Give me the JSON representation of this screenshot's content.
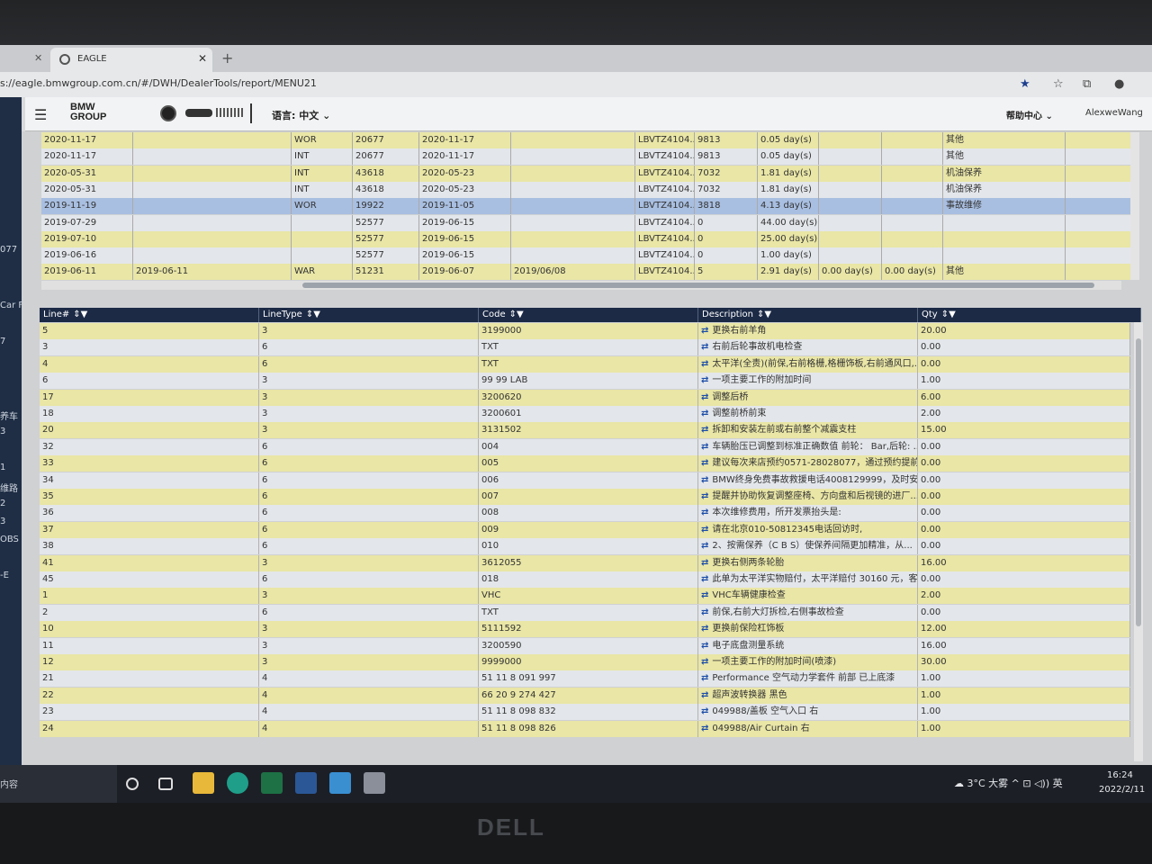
{
  "browser": {
    "tab_title": "EAGLE",
    "url": "s://eagle.bmwgroup.com.cn/#/DWH/DealerTools/report/MENU21"
  },
  "header": {
    "brand_line1": "BMW",
    "brand_line2": "GROUP",
    "language": "语言: 中文",
    "help": "帮助中心",
    "user": "AlexweWang"
  },
  "sidebar": {
    "fragments": [
      "077",
      "Car F",
      "7",
      "养车",
      "3",
      "1",
      "维路",
      "2",
      "3",
      "OBS",
      "-E"
    ]
  },
  "upper_table": {
    "rows": [
      {
        "c1": "2020-11-17",
        "c2": "",
        "c3": "WOR",
        "c4": "20677",
        "c5": "2020-11-17",
        "c6": "",
        "c7": "LBVTZ4104...",
        "c8": "9813",
        "c9": "0.05 day(s)",
        "c10": "",
        "c11": "",
        "c12": "其他",
        "selected": false
      },
      {
        "c1": "2020-11-17",
        "c2": "",
        "c3": "INT",
        "c4": "20677",
        "c5": "2020-11-17",
        "c6": "",
        "c7": "LBVTZ4104...",
        "c8": "9813",
        "c9": "0.05 day(s)",
        "c10": "",
        "c11": "",
        "c12": "其他",
        "selected": false
      },
      {
        "c1": "2020-05-31",
        "c2": "",
        "c3": "INT",
        "c4": "43618",
        "c5": "2020-05-23",
        "c6": "",
        "c7": "LBVTZ4104...",
        "c8": "7032",
        "c9": "1.81 day(s)",
        "c10": "",
        "c11": "",
        "c12": "机油保养",
        "selected": false
      },
      {
        "c1": "2020-05-31",
        "c2": "",
        "c3": "INT",
        "c4": "43618",
        "c5": "2020-05-23",
        "c6": "",
        "c7": "LBVTZ4104...",
        "c8": "7032",
        "c9": "1.81 day(s)",
        "c10": "",
        "c11": "",
        "c12": "机油保养",
        "selected": false
      },
      {
        "c1": "2019-11-19",
        "c2": "",
        "c3": "WOR",
        "c4": "19922",
        "c5": "2019-11-05",
        "c6": "",
        "c7": "LBVTZ4104...",
        "c8": "3818",
        "c9": "4.13 day(s)",
        "c10": "",
        "c11": "",
        "c12": "事故维修",
        "selected": true
      },
      {
        "c1": "2019-07-29",
        "c2": "",
        "c3": "",
        "c4": "52577",
        "c5": "2019-06-15",
        "c6": "",
        "c7": "LBVTZ4104...",
        "c8": "0",
        "c9": "44.00 day(s)",
        "c10": "",
        "c11": "",
        "c12": "",
        "selected": false
      },
      {
        "c1": "2019-07-10",
        "c2": "",
        "c3": "",
        "c4": "52577",
        "c5": "2019-06-15",
        "c6": "",
        "c7": "LBVTZ4104...",
        "c8": "0",
        "c9": "25.00 day(s)",
        "c10": "",
        "c11": "",
        "c12": "",
        "selected": false
      },
      {
        "c1": "2019-06-16",
        "c2": "",
        "c3": "",
        "c4": "52577",
        "c5": "2019-06-15",
        "c6": "",
        "c7": "LBVTZ4104...",
        "c8": "0",
        "c9": "1.00 day(s)",
        "c10": "",
        "c11": "",
        "c12": "",
        "selected": false
      },
      {
        "c1": "2019-06-11",
        "c2": "2019-06-11",
        "c3": "WAR",
        "c4": "51231",
        "c5": "2019-06-07",
        "c6": "2019/06/08",
        "c7": "LBVTZ4104...",
        "c8": "5",
        "c9": "2.91 day(s)",
        "c10": "0.00 day(s)",
        "c11": "0.00 day(s)",
        "c12": "其他",
        "selected": false
      }
    ]
  },
  "lower_table": {
    "headers": [
      "Line#",
      "LineType",
      "Code",
      "Description",
      "Qty"
    ],
    "sort_filter_glyph": "⇕▼",
    "rows": [
      {
        "line": "5",
        "type": "3",
        "code": "3199000",
        "desc": "更换右前羊角",
        "qty": "20.00"
      },
      {
        "line": "3",
        "type": "6",
        "code": "TXT",
        "desc": "右前后轮事故机电检查",
        "qty": "0.00"
      },
      {
        "line": "4",
        "type": "6",
        "code": "TXT",
        "desc": "太平洋(全责)(前保,右前格栅,格栅饰板,右前通风口,...",
        "qty": "0.00"
      },
      {
        "line": "6",
        "type": "3",
        "code": "99 99 LAB",
        "desc": "一项主要工作的附加时间",
        "qty": "1.00"
      },
      {
        "line": "17",
        "type": "3",
        "code": "3200620",
        "desc": "调整后桥",
        "qty": "6.00"
      },
      {
        "line": "18",
        "type": "3",
        "code": "3200601",
        "desc": "调整前桥前束",
        "qty": "2.00"
      },
      {
        "line": "20",
        "type": "3",
        "code": "3131502",
        "desc": "拆卸和安装左前或右前整个减震支柱",
        "qty": "15.00"
      },
      {
        "line": "32",
        "type": "6",
        "code": "004",
        "desc": "车辆胎压已调整到标准正确数值 前轮： Bar,后轮: ...",
        "qty": "0.00"
      },
      {
        "line": "33",
        "type": "6",
        "code": "005",
        "desc": "建议每次来店预约0571-28028077，通过预约提前...",
        "qty": "0.00"
      },
      {
        "line": "34",
        "type": "6",
        "code": "006",
        "desc": "BMW终身免费事故救援电话4008129999，及时安...",
        "qty": "0.00"
      },
      {
        "line": "35",
        "type": "6",
        "code": "007",
        "desc": "提醒并协助恢复调整座椅、方向盘和后视镜的进厂...",
        "qty": "0.00"
      },
      {
        "line": "36",
        "type": "6",
        "code": "008",
        "desc": "本次维修费用，所开发票抬头是:",
        "qty": "0.00"
      },
      {
        "line": "37",
        "type": "6",
        "code": "009",
        "desc": "请在北京010-50812345电话回访时,",
        "qty": "0.00"
      },
      {
        "line": "38",
        "type": "6",
        "code": "010",
        "desc": "2、按需保养（C B S）使保养间隔更加精准，从...",
        "qty": "0.00"
      },
      {
        "line": "41",
        "type": "3",
        "code": "3612055",
        "desc": "更换右侧两条轮胎",
        "qty": "16.00"
      },
      {
        "line": "45",
        "type": "6",
        "code": "018",
        "desc": "此单为太平洋实物赔付，太平洋赔付 30160 元，客...",
        "qty": "0.00"
      },
      {
        "line": "1",
        "type": "3",
        "code": "VHC",
        "desc": "VHC车辆健康检查",
        "qty": "2.00"
      },
      {
        "line": "2",
        "type": "6",
        "code": "TXT",
        "desc": "前保,右前大灯拆检,右侧事故检查",
        "qty": "0.00"
      },
      {
        "line": "10",
        "type": "3",
        "code": "5111592",
        "desc": "更换前保险杠饰板",
        "qty": "12.00"
      },
      {
        "line": "11",
        "type": "3",
        "code": "3200590",
        "desc": "电子底盘测量系统",
        "qty": "16.00"
      },
      {
        "line": "12",
        "type": "3",
        "code": "9999000",
        "desc": "一项主要工作的附加时间(喷漆)",
        "qty": "30.00"
      },
      {
        "line": "21",
        "type": "4",
        "code": "51 11 8 091 997",
        "desc": "Performance 空气动力学套件 前部 已上底漆",
        "qty": "1.00"
      },
      {
        "line": "22",
        "type": "4",
        "code": "66 20 9 274 427",
        "desc": "超声波转换器 黑色",
        "qty": "1.00"
      },
      {
        "line": "23",
        "type": "4",
        "code": "51 11 8 098 832",
        "desc": "049988/盖板 空气入口 右",
        "qty": "1.00"
      },
      {
        "line": "24",
        "type": "4",
        "code": "51 11 8 098 826",
        "desc": "049988/Air Curtain 右",
        "qty": "1.00"
      }
    ]
  },
  "taskbar": {
    "search_placeholder": "内容",
    "tray_text": "3°C 大雾  ^  ⊡ ◁)) 英",
    "time": "16:24",
    "date": "2022/2/11"
  },
  "monitor": {
    "brand": "DELL"
  }
}
